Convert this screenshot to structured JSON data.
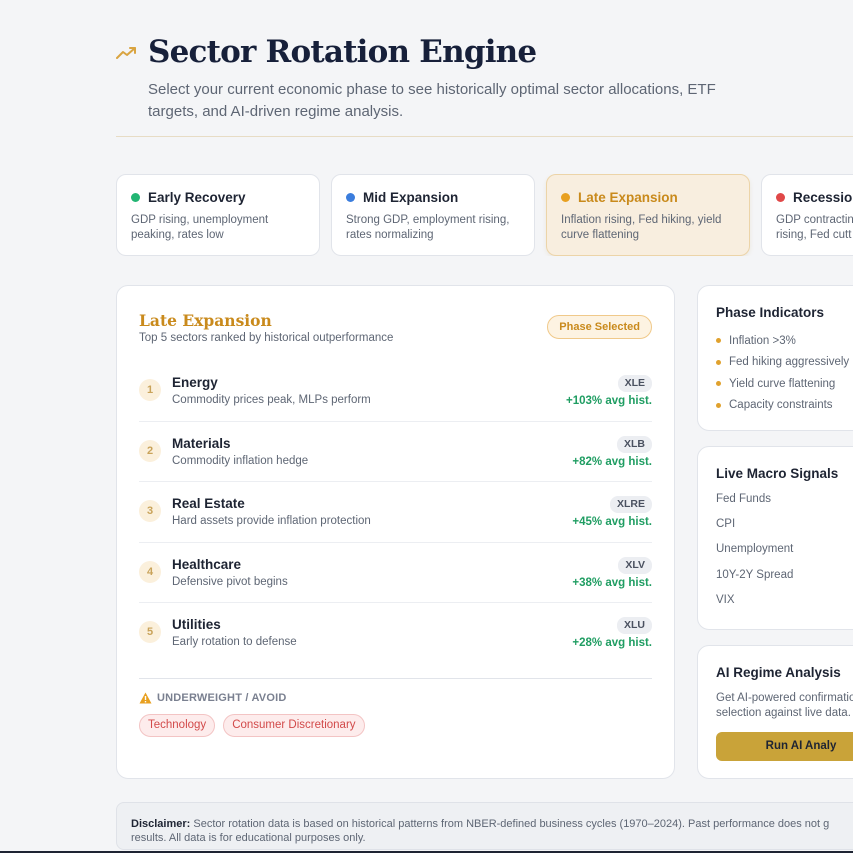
{
  "header": {
    "title": "Sector Rotation Engine",
    "subtitle": "Select your current economic phase to see historically optimal sector allocations, ETF targets, and AI-driven regime analysis.",
    "accent_color": "#c98a1c",
    "icon": "trending-up-icon"
  },
  "phases": [
    {
      "name": "Early Recovery",
      "desc1": "GDP rising, unemployment",
      "desc2": "peaking, rates low",
      "color": "#22b573",
      "active": false
    },
    {
      "name": "Mid Expansion",
      "desc1": "Strong GDP, employment rising,",
      "desc2": "rates normalizing",
      "color": "#3b7ddd",
      "active": false
    },
    {
      "name": "Late Expansion",
      "desc1": "Inflation rising, Fed hiking, yield",
      "desc2": "curve flattening",
      "color": "#e8a020",
      "active": true
    },
    {
      "name": "Recession",
      "desc1": "GDP contracting",
      "desc2": "rising, Fed cutt",
      "color": "#e04848",
      "active": false
    }
  ],
  "main": {
    "title": "Late Expansion",
    "subtitle": "Top 5 sectors ranked by historical outperformance",
    "badge": "Phase Selected",
    "sectors": [
      {
        "rank": "1",
        "name": "Energy",
        "reason": "Commodity prices peak, MLPs perform",
        "ticker": "XLE",
        "perf": "+103% avg hist."
      },
      {
        "rank": "2",
        "name": "Materials",
        "reason": "Commodity inflation hedge",
        "ticker": "XLB",
        "perf": "+82% avg hist."
      },
      {
        "rank": "3",
        "name": "Real Estate",
        "reason": "Hard assets provide inflation protection",
        "ticker": "XLRE",
        "perf": "+45% avg hist."
      },
      {
        "rank": "4",
        "name": "Healthcare",
        "reason": "Defensive pivot begins",
        "ticker": "XLV",
        "perf": "+38% avg hist."
      },
      {
        "rank": "5",
        "name": "Utilities",
        "reason": "Early rotation to defense",
        "ticker": "XLU",
        "perf": "+28% avg hist."
      }
    ],
    "avoid_label": "UNDERWEIGHT / AVOID",
    "avoid_tags": [
      "Technology",
      "Consumer Discretionary"
    ]
  },
  "indicators": {
    "title": "Phase Indicators",
    "items": [
      "Inflation >3%",
      "Fed hiking aggressively",
      "Yield curve flattening",
      "Capacity constraints"
    ]
  },
  "signals": {
    "title": "Live Macro Signals",
    "items": [
      "Fed Funds",
      "CPI",
      "Unemployment",
      "10Y-2Y Spread",
      "VIX"
    ]
  },
  "ai": {
    "title": "AI Regime Analysis",
    "desc1": "Get AI-powered confirmatio",
    "desc2": "selection against live data.",
    "button": "Run AI Analy"
  },
  "disclaimer": {
    "label": "Disclaimer:",
    "text": "Sector rotation data is based on historical patterns from NBER-defined business cycles (1970–2024). Past performance does not g results. All data is for educational purposes only."
  }
}
